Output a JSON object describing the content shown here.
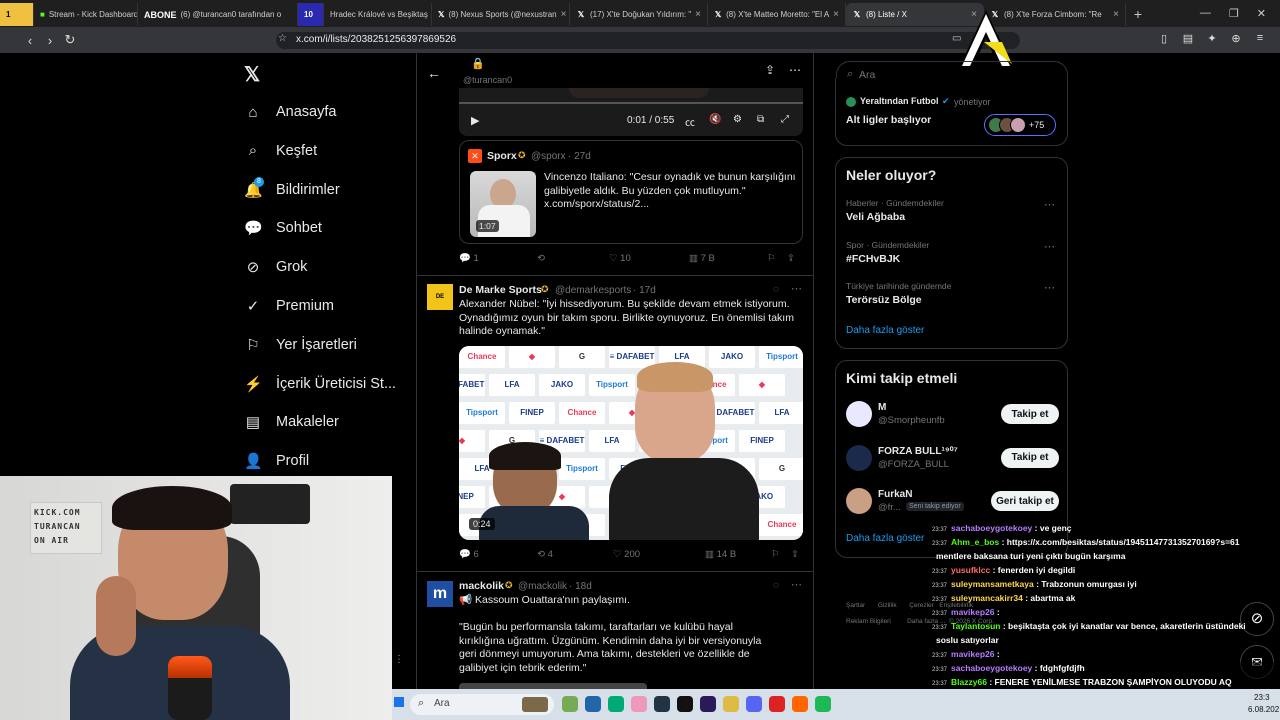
{
  "tabs": [
    {
      "label": "Stream - Kick Dashboard",
      "active": false
    },
    {
      "label": "ABONE",
      "active": false
    },
    {
      "label": "(6) @turancan0 tarafından o",
      "active": false
    },
    {
      "label": "Hradec Králové vs Beşiktaş",
      "active": false
    },
    {
      "label": "(8) Nexus Sports (@nexustran",
      "active": false
    },
    {
      "label": "(17) X'te Doğukan Yıldırım: \"",
      "active": false
    },
    {
      "label": "(8) X'te Matteo Moretto: \"El A",
      "active": false
    },
    {
      "label": "(8) Liste / X",
      "active": true
    },
    {
      "label": "(8) X'te Forza Cimbom: \"Re",
      "active": false
    }
  ],
  "tab_badge": "10",
  "address": {
    "url": "x.com/i/lists/2038251256397869526"
  },
  "nav": {
    "items": [
      {
        "label": "Anasayfa",
        "icon": "home-icon"
      },
      {
        "label": "Keşfet",
        "icon": "search-icon"
      },
      {
        "label": "Bildirimler",
        "icon": "bell-icon",
        "badge": "8"
      },
      {
        "label": "Sohbet",
        "icon": "chat-icon"
      },
      {
        "label": "Grok",
        "icon": "grok-icon"
      },
      {
        "label": "Premium",
        "icon": "premium-icon"
      },
      {
        "label": "Yer İşaretleri",
        "icon": "bookmark-icon"
      },
      {
        "label": "İçerik Üreticisi St...",
        "icon": "creator-icon"
      },
      {
        "label": "Makaleler",
        "icon": "articles-icon"
      },
      {
        "label": "Profil",
        "icon": "profile-icon"
      }
    ]
  },
  "feed": {
    "top_handle": "@turancan0",
    "video1": {
      "time": "0:01 / 0:55"
    },
    "quote": {
      "name": "Sporx",
      "handle": "@sporx",
      "age": "27d",
      "text": "Vincenzo Italiano: \"Cesur oynadık ve bunun karşılığını galibiyetle aldık. Bu yüzden çok mutluyum.\" x.com/sporx/status/2...",
      "duration": "1:07"
    },
    "tweet1_actions": {
      "replies": "1",
      "likes": "10",
      "views": "7 B"
    },
    "tweet2": {
      "name": "De Marke Sports",
      "handle": "@demarkesports",
      "age": "17d",
      "text": "Alexander Nübel: \"İyi hissediyorum. Bu şekilde devam etmek istiyorum. Oynadığımız oyun bir takım sporu. Birlikte oynuyoruz. En önemlisi takım halinde oynamak.\"",
      "duration": "0:24",
      "replies": "6",
      "retweets": "4",
      "likes": "200",
      "views": "14 B"
    },
    "tweet3": {
      "name": "mackolik",
      "handle": "@mackolik",
      "age": "18d",
      "line1": "Kassoum Ouattara'nın paylaşımı.",
      "text": "\"Bugün bu performansla takımı, taraftarları ve kulübü hayal kırıklığına uğrattım. Üzgünüm. Kendimin daha iyi bir versiyonuyla geri dönmeyi umuyorum. Ama takımı, destekleri ve özellikle de galibiyet için tebrik ederim.\""
    }
  },
  "right": {
    "search_placeholder": "Ara",
    "community": {
      "name": "Yeraltından Futbol",
      "role": "yönetiyor",
      "title": "Alt ligler başlıyor",
      "count": "+75"
    },
    "trends_title": "Neler oluyor?",
    "trends": [
      {
        "meta": "Haberler · Gündemdekiler",
        "name": "Veli Ağbaba"
      },
      {
        "meta": "Spor · Gündemdekiler",
        "name": "#FCHvBJK"
      },
      {
        "meta": "Türkiye tarihinde gündemde",
        "name": "Terörsüz Bölge"
      }
    ],
    "show_more": "Daha fazla göster",
    "follow_title": "Kimi takip etmeli",
    "follows": [
      {
        "name": "M",
        "handle": "@Smorpheunfb",
        "button": "Takip et"
      },
      {
        "name": "FORZA BULL¹⁹⁰⁷",
        "handle": "@FORZA_BULL",
        "button": "Takip et"
      },
      {
        "name": "FurkaN",
        "handle": "@fr...",
        "tag": "Seni takip ediyor",
        "button": "Geri takip et"
      }
    ],
    "follow_more": "Daha fazla göster",
    "footer": [
      "Şartlar",
      "Gizlilik",
      "Çerezler",
      "Erişilebilirlik",
      "Reklam Bilgileri",
      "Daha fazla ...",
      "© 2026 X Corp."
    ]
  },
  "webcam": {
    "sign": [
      "KICK.COM",
      "TURANCAN",
      "ON AIR"
    ]
  },
  "chat": [
    {
      "time": "23:37",
      "user": "sachaboeygotekoey",
      "color": "#b77cff",
      "msg": ": ve genç"
    },
    {
      "time": "23:37",
      "user": "Ahm_e_bos",
      "color": "#53fc18",
      "msg": ": https://x.com/besiktas/status/1945114773135270169?s=61"
    },
    {
      "time": "",
      "user": "",
      "color": "#ffffff",
      "msg": "mentlere baksana turi yeni çıktı bugün karşıma"
    },
    {
      "time": "23:37",
      "user": "yusufklcc",
      "color": "#ff6b6b",
      "msg": ": fenerden iyi degildi"
    },
    {
      "time": "23:37",
      "user": "suleymansametkaya",
      "color": "#ffd84a",
      "msg": ": Trabzonun omurgası iyi"
    },
    {
      "time": "23:37",
      "user": "suleymancakirr34",
      "color": "#ffd84a",
      "msg": ": abartma ak"
    },
    {
      "time": "23:37",
      "user": "mavikep26",
      "color": "#b77cff",
      "msg": ":"
    },
    {
      "time": "23:37",
      "user": "Taylantosun",
      "color": "#53fc18",
      "msg": ": beşiktaşta çok iyi kanatlar var bence, akaretlerin üstündeki"
    },
    {
      "time": "",
      "user": "",
      "color": "#ffffff",
      "msg": "soslu satıyorlar"
    },
    {
      "time": "23:37",
      "user": "mavikep26",
      "color": "#b77cff",
      "msg": ":"
    },
    {
      "time": "23:37",
      "user": "sachaboeygotekoey",
      "color": "#b77cff",
      "msg": ": fdghfgfdjfh"
    },
    {
      "time": "23:37",
      "user": "Blazzy66",
      "color": "#53fc18",
      "msg": ": FENERE YENİLMESE TRABZON ŞAMPİYON OLUYODU AQ"
    }
  ],
  "taskbar": {
    "search_placeholder": "Ara",
    "clock": "23:3",
    "date": "6.08.202"
  }
}
